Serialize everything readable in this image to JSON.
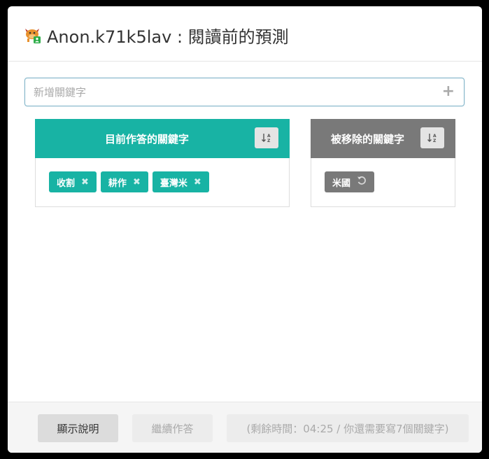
{
  "header": {
    "title": "Anon.k71k5lav : 閱讀前的預測",
    "logo_icon": "cow-mascot-icon"
  },
  "input": {
    "placeholder": "新增關鍵字",
    "value": ""
  },
  "active_panel": {
    "title": "目前作答的關鍵字",
    "color": "#18b3a4",
    "tags": [
      "收割",
      "耕作",
      "臺灣米"
    ]
  },
  "removed_panel": {
    "title": "被移除的關鍵字",
    "color": "#797979",
    "tags": [
      "米國"
    ]
  },
  "footer": {
    "help_label": "顯示說明",
    "continue_label": "繼續作答",
    "status_label": "(剩餘時間：04:25 / 你還需要寫7個關鍵字)"
  },
  "icons": {
    "remove": "close-icon",
    "restore": "undo-icon",
    "sort": "sort-alpha-icon",
    "add": "plus-icon"
  }
}
